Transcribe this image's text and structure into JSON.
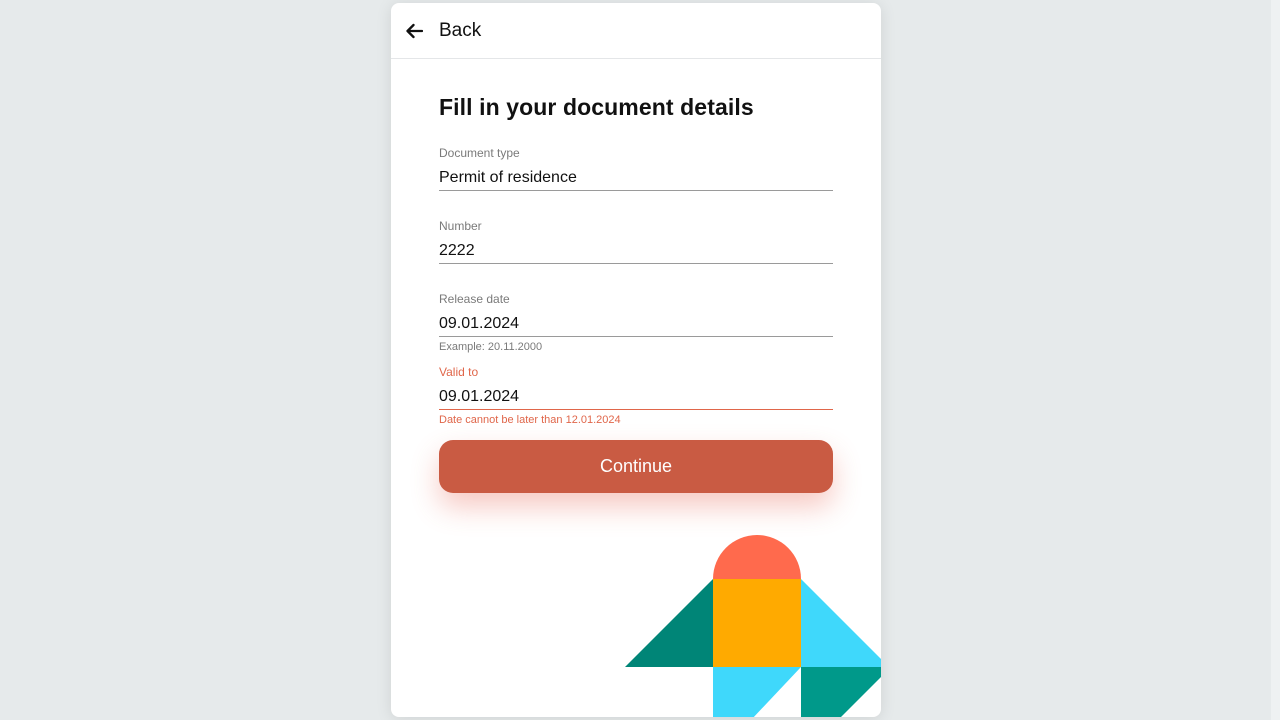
{
  "header": {
    "back_label": "Back",
    "back_icon": "arrow-left-icon"
  },
  "form": {
    "title": "Fill in your document details",
    "fields": [
      {
        "label": "Document type",
        "value": "Permit of residence",
        "helper": ""
      },
      {
        "label": "Number",
        "value": "2222",
        "helper": ""
      },
      {
        "label": "Release date",
        "value": "09.01.2024",
        "helper": "Example: 20.11.2000"
      },
      {
        "label": "Valid to",
        "value": "09.01.2024",
        "helper": "Date cannot be later than 12.01.2024",
        "state": "error"
      }
    ],
    "continue_label": "Continue"
  },
  "colors": {
    "accent": "#c95b43",
    "error": "#e0664a",
    "illustration_coral": "#ff6a4d",
    "illustration_amber": "#ffaa00",
    "illustration_teal": "#008577",
    "illustration_teal_light": "#00998a",
    "illustration_cyan": "#3fd8fb"
  }
}
